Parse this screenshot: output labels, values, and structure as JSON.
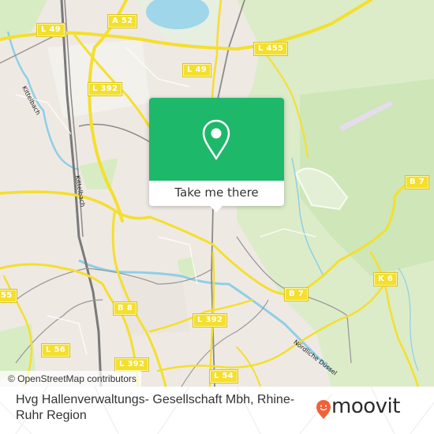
{
  "map": {
    "attribution": "© OpenStreetMap contributors",
    "road_labels": [
      {
        "id": "l49-a",
        "text": "L 49"
      },
      {
        "id": "a52",
        "text": "A 52"
      },
      {
        "id": "l455-top",
        "text": "L 455"
      },
      {
        "id": "l49-b",
        "text": "L 49"
      },
      {
        "id": "l392-top",
        "text": "L 392"
      },
      {
        "id": "b7-right",
        "text": "B 7"
      },
      {
        "id": "k6",
        "text": "K 6"
      },
      {
        "id": "b7-mid",
        "text": "B 7"
      },
      {
        "id": "l455-left",
        "text": "55"
      },
      {
        "id": "b8",
        "text": "B 8"
      },
      {
        "id": "l392-mid",
        "text": "L 392"
      },
      {
        "id": "l56",
        "text": "L 56"
      },
      {
        "id": "l392-bottom",
        "text": "L 392"
      },
      {
        "id": "l54",
        "text": "L 54"
      }
    ],
    "water_labels": [
      {
        "id": "kittelbach-1",
        "text": "Kittelbach"
      },
      {
        "id": "kittelbach-2",
        "text": "Kittelbach"
      },
      {
        "id": "noerdliche-duessel",
        "text": "Nördliche Düssel"
      }
    ],
    "colors": {
      "land": "#efe9e4",
      "park": "#d8ecc4",
      "water": "#8ecfe6",
      "road_major": "#f4df2c",
      "rail": "#7a7a7a"
    }
  },
  "popup": {
    "icon": "map-pin-icon",
    "cta_label": "Take me there",
    "accent_color": "#1eb86a"
  },
  "footer": {
    "place_name": "Hvg Hallenverwaltungs- Gesellschaft Mbh, Rhine-Ruhr Region",
    "logo_text": "moovit",
    "logo_color": "#f0623a"
  }
}
